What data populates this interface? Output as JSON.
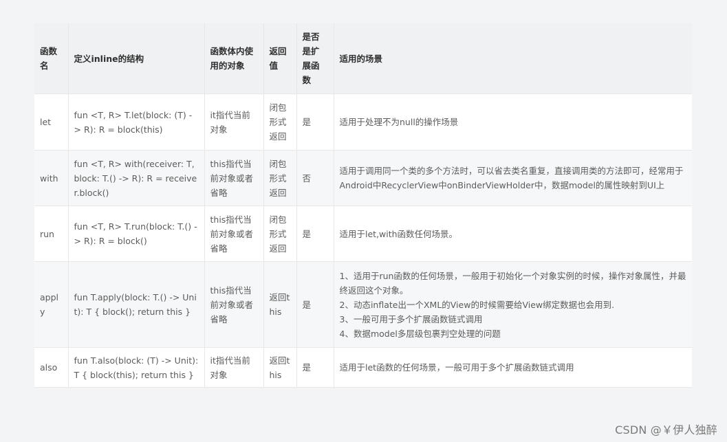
{
  "headers": {
    "name": "函数名",
    "definition": "定义inline的结构",
    "object": "函数体内使用的对象",
    "return_value": "返回值",
    "is_extension": "是否是扩展函数",
    "scenario": "适用的场景"
  },
  "rows": [
    {
      "name": "let",
      "definition": "fun <T, R> T.let(block: (T) -> R): R = block(this)",
      "object": "it指代当前对象",
      "return_value": "闭包形式返回",
      "is_extension": "是",
      "scenario": [
        "适用于处理不为null的操作场景"
      ]
    },
    {
      "name": "with",
      "definition": "fun <T, R> with(receiver: T, block: T.() -> R): R = receiver.block()",
      "object": "this指代当前对象或者省略",
      "return_value": "闭包形式返回",
      "is_extension": "否",
      "scenario": [
        "适用于调用同一个类的多个方法时，可以省去类名重复，直接调用类的方法即可，经常用于Android中RecyclerView中onBinderViewHolder中，数据model的属性映射到UI上"
      ]
    },
    {
      "name": "run",
      "definition": "fun <T, R> T.run(block: T.() -> R): R = block()",
      "object": "this指代当前对象或者省略",
      "return_value": "闭包形式返回",
      "is_extension": "是",
      "scenario": [
        "适用于let,with函数任何场景。"
      ]
    },
    {
      "name": "apply",
      "definition": "fun T.apply(block: T.() -> Unit): T { block(); return this }",
      "object": "this指代当前对象或者省略",
      "return_value": "返回this",
      "is_extension": "是",
      "scenario": [
        "1、适用于run函数的任何场景，一般用于初始化一个对象实例的时候，操作对象属性，并最终返回这个对象。",
        "2、动态inflate出一个XML的View的时候需要给View绑定数据也会用到.",
        "3、一般可用于多个扩展函数链式调用",
        "4、数据model多层级包裹判空处理的问题"
      ]
    },
    {
      "name": "also",
      "definition": "fun T.also(block: (T) -> Unit): T { block(this); return this }",
      "object": "it指代当前对象",
      "return_value": "返回this",
      "is_extension": "是",
      "scenario": [
        "适用于let函数的任何场景，一般可用于多个扩展函数链式调用"
      ]
    }
  ],
  "watermark": "CSDN @￥伊人独醉"
}
